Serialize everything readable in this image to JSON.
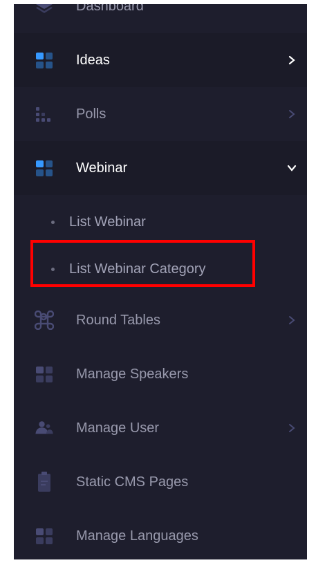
{
  "sidebar": {
    "items": [
      {
        "label": "Dashboard",
        "icon": "layers-icon"
      },
      {
        "label": "Ideas",
        "icon": "grid-icon",
        "chevron": "right"
      },
      {
        "label": "Polls",
        "icon": "bar-chart-icon",
        "chevron": "right"
      },
      {
        "label": "Webinar",
        "icon": "grid-icon",
        "chevron": "down"
      },
      {
        "label": "Round Tables",
        "icon": "command-icon",
        "chevron": "right"
      },
      {
        "label": "Manage Speakers",
        "icon": "grid-icon"
      },
      {
        "label": "Manage User",
        "icon": "users-icon",
        "chevron": "right"
      },
      {
        "label": "Static CMS Pages",
        "icon": "clipboard-icon"
      },
      {
        "label": "Manage Languages",
        "icon": "grid-icon"
      }
    ],
    "webinar_submenu": [
      {
        "label": "List Webinar"
      },
      {
        "label": "List Webinar Category"
      }
    ]
  },
  "colors": {
    "sidebar_bg": "#1e1e2d",
    "active_icon": "#3699ff",
    "muted_icon": "#494b74",
    "highlight": "#ff0000"
  }
}
